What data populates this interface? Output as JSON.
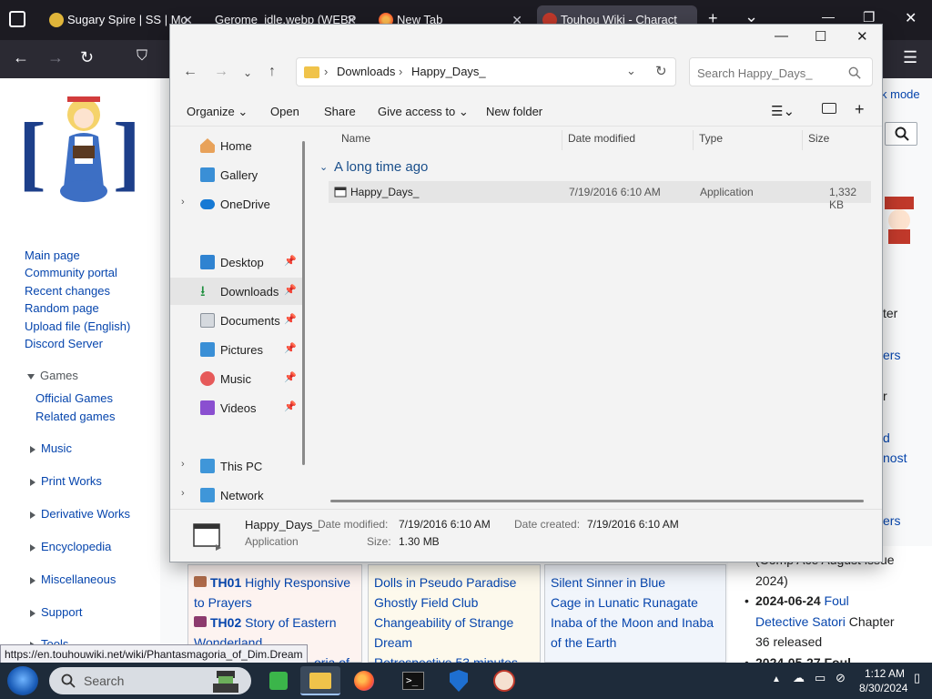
{
  "browser": {
    "tabs": [
      {
        "label": "Sugary Spire | SS | Mo"
      },
      {
        "label": "Gerome_idle.webp (WEBP"
      },
      {
        "label": "New Tab"
      },
      {
        "label": "Touhou Wiki - Charact"
      }
    ],
    "new_tab": "+",
    "list_all_tabs": "⌄",
    "window_controls": {
      "minimize": "—",
      "restore": "❐",
      "close": "✕"
    }
  },
  "wiki": {
    "sidebar": {
      "links": [
        "Main page",
        "Community portal",
        "Recent changes",
        "Random page",
        "Upload file (English)",
        "Discord Server"
      ],
      "games": {
        "title": "Games",
        "items": [
          "Official Games",
          "Related games"
        ]
      },
      "sections": [
        "Music",
        "Print Works",
        "Derivative Works",
        "Encyclopedia",
        "Miscellaneous",
        "Support",
        "Tools"
      ]
    },
    "dark_mode": "k mode",
    "right_fragments": [
      "ter",
      "ers",
      "r",
      "d",
      "nost",
      "ers"
    ],
    "games_boxes": [
      {
        "lines": [
          {
            "num": "TH01",
            "text": "Highly Responsive"
          },
          {
            "text": "to Prayers"
          },
          {
            "num": "TH02",
            "text": "Story of Eastern"
          },
          {
            "text": "Wonderland"
          },
          {
            "text": "oria of"
          }
        ]
      },
      {
        "lines": [
          "Dolls in Pseudo Paradise",
          "Ghostly Field Club",
          "Changeability of Strange",
          "Dream",
          "Retrospective 53 minutes"
        ]
      },
      {
        "lines": [
          "Silent Sinner in Blue",
          "Cage in Lunatic Runagate",
          "Inaba of the Moon and Inaba",
          "of the Earth"
        ]
      }
    ],
    "news": {
      "lines": [
        "(Comp Ace August issue",
        "2024)"
      ],
      "item_date": "2024-06-24",
      "item_link": "Foul Detective Satori",
      "item_text": "Chapter 36 released",
      "cut": "2024-05-27 Foul"
    },
    "status_url": "https://en.touhouwiki.net/wiki/Phantasmagoria_of_Dim.Dream"
  },
  "explorer": {
    "controls": {
      "minimize": "—",
      "maximize": "☐",
      "close": "✕"
    },
    "breadcrumb": [
      "Downloads",
      "Happy_Days_"
    ],
    "search_placeholder": "Search Happy_Days_",
    "commands": {
      "organize": "Organize",
      "open": "Open",
      "share": "Share",
      "give_access": "Give access to",
      "new_folder": "New folder"
    },
    "nav": [
      {
        "label": "Home"
      },
      {
        "label": "Gallery"
      },
      {
        "label": "OneDrive"
      },
      {
        "label": "Desktop"
      },
      {
        "label": "Downloads"
      },
      {
        "label": "Documents"
      },
      {
        "label": "Pictures"
      },
      {
        "label": "Music"
      },
      {
        "label": "Videos"
      },
      {
        "label": "This PC"
      },
      {
        "label": "Network"
      }
    ],
    "columns": {
      "name": "Name",
      "date": "Date modified",
      "type": "Type",
      "size": "Size"
    },
    "group": "A long time ago",
    "file": {
      "name": "Happy_Days_",
      "date": "7/19/2016 6:10 AM",
      "type": "Application",
      "size": "1,332 KB"
    },
    "details": {
      "name": "Happy_Days_",
      "type": "Application",
      "date_modified_label": "Date modified:",
      "date_modified": "7/19/2016 6:10 AM",
      "date_created_label": "Date created:",
      "date_created": "7/19/2016 6:10 AM",
      "size_label": "Size:",
      "size": "1.30 MB"
    }
  },
  "taskbar": {
    "search": "Search",
    "time": "1:12 AM",
    "date": "8/30/2024"
  }
}
